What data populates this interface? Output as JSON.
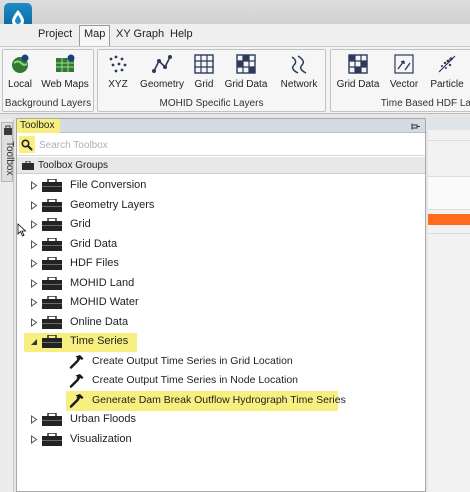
{
  "menu": {
    "items": [
      "Project",
      "Map",
      "XY Graph",
      "Help"
    ],
    "active": "Map"
  },
  "ribbon": {
    "groups": [
      {
        "label": "Background Layers",
        "buttons": [
          {
            "label": "Local",
            "icon": "globe-local-icon"
          },
          {
            "label": "Web Maps",
            "icon": "globe-web-icon"
          }
        ]
      },
      {
        "label": "MOHID Specific Layers",
        "buttons": [
          {
            "label": "XYZ",
            "icon": "xyz-points-icon"
          },
          {
            "label": "Geometry",
            "icon": "geometry-icon"
          },
          {
            "label": "Grid",
            "icon": "grid-icon"
          },
          {
            "label": "Grid Data",
            "icon": "grid-data-icon"
          },
          {
            "label": "Network",
            "icon": "network-icon"
          }
        ]
      },
      {
        "label": "Time Based HDF La",
        "buttons": [
          {
            "label": "Grid Data",
            "icon": "grid-data-icon"
          },
          {
            "label": "Vector",
            "icon": "vector-icon"
          },
          {
            "label": "Particle",
            "icon": "particle-icon"
          }
        ]
      }
    ]
  },
  "side_tab": {
    "label": "Toolbox"
  },
  "toolbox": {
    "title": "Toolbox",
    "search_placeholder": "Search Toolbox",
    "groups_header": "Toolbox Groups",
    "groups": [
      {
        "label": "File Conversion",
        "expanded": false
      },
      {
        "label": "Geometry Layers",
        "expanded": false
      },
      {
        "label": "Grid",
        "expanded": false
      },
      {
        "label": "Grid Data",
        "expanded": false
      },
      {
        "label": "HDF Files",
        "expanded": false
      },
      {
        "label": "MOHID Land",
        "expanded": false
      },
      {
        "label": "MOHID Water",
        "expanded": false
      },
      {
        "label": "Online Data",
        "expanded": false
      },
      {
        "label": "Time Series",
        "expanded": true,
        "highlighted": true,
        "tools": [
          {
            "label": "Create Output Time Series in Grid Location"
          },
          {
            "label": "Create Output Time Series in Node Location"
          },
          {
            "label": "Generate Dam Break Outflow Hydrograph Time Series",
            "highlighted": true
          }
        ]
      },
      {
        "label": "Urban Floods",
        "expanded": false
      },
      {
        "label": "Visualization",
        "expanded": false
      }
    ]
  },
  "colors": {
    "highlight": "#f7f080",
    "app_icon": "#0a5f93",
    "accent_orange": "#ff6a1f"
  }
}
